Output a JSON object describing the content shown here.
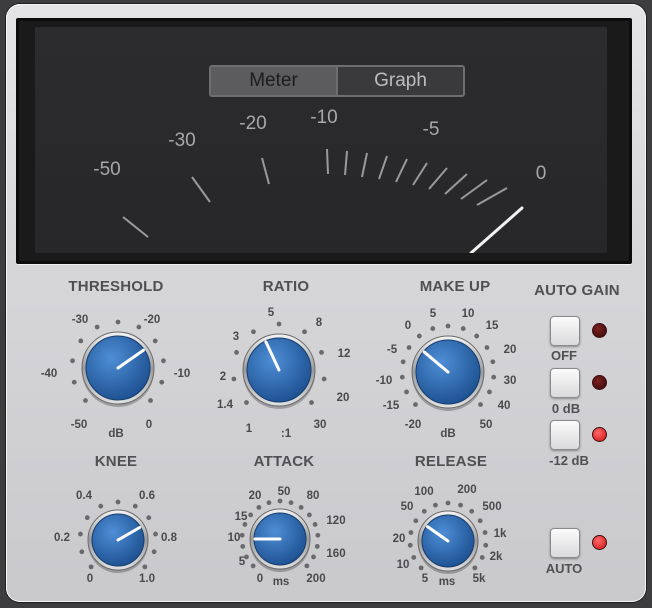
{
  "view_toggle": {
    "options": [
      "Meter",
      "Graph"
    ],
    "selected": "Meter"
  },
  "meter": {
    "scale_labels": [
      "-50",
      "-30",
      "-20",
      "-10",
      "-5",
      "0"
    ],
    "needle_db": 0
  },
  "knobs": {
    "threshold": {
      "title": "THRESHOLD",
      "unit": "dB",
      "scale": [
        "-50",
        "-40",
        "-30",
        "-20",
        "-10",
        "0"
      ]
    },
    "ratio": {
      "title": "RATIO",
      "unit": ":1",
      "scale": [
        "1",
        "1.4",
        "2",
        "3",
        "5",
        "8",
        "12",
        "20",
        "30"
      ]
    },
    "makeup": {
      "title": "MAKE UP",
      "unit": "dB",
      "scale": [
        "-20",
        "-15",
        "-10",
        "-5",
        "0",
        "5",
        "10",
        "15",
        "20",
        "30",
        "40",
        "50"
      ]
    },
    "knee": {
      "title": "KNEE",
      "unit": "",
      "scale": [
        "0",
        "0.2",
        "0.4",
        "0.6",
        "0.8",
        "1.0"
      ]
    },
    "attack": {
      "title": "ATTACK",
      "unit": "ms",
      "scale": [
        "0",
        "5",
        "10",
        "15",
        "20",
        "50",
        "80",
        "120",
        "160",
        "200"
      ]
    },
    "release": {
      "title": "RELEASE",
      "unit": "ms",
      "scale": [
        "5",
        "10",
        "20",
        "50",
        "100",
        "200",
        "500",
        "1k",
        "2k",
        "5k"
      ]
    }
  },
  "auto_gain": {
    "title": "AUTO GAIN",
    "options": [
      {
        "label": "OFF",
        "led_on": false
      },
      {
        "label": "0 dB",
        "led_on": false
      },
      {
        "label": "-12 dB",
        "led_on": true
      }
    ],
    "auto": {
      "label": "AUTO",
      "led_on": true
    }
  },
  "colors": {
    "knob": "#2a63a8",
    "led_on": "#e81c1c",
    "panel": "#d6d6d9",
    "meter_bg": "#2a2a2c"
  }
}
